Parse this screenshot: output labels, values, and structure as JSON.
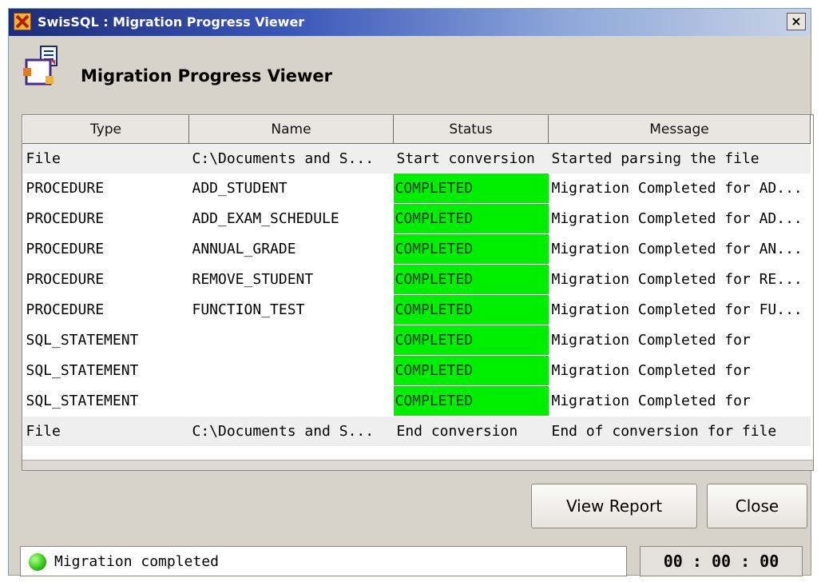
{
  "window": {
    "title": "SwisSQL : Migration Progress Viewer",
    "close_symbol": "×",
    "app_icon": "swissql-logo-icon",
    "close_icon": "close-icon"
  },
  "header": {
    "title": "Migration Progress Viewer",
    "icon": "migration-viewer-icon"
  },
  "table": {
    "columns": [
      "Type",
      "Name",
      "Status",
      "Message"
    ],
    "rows": [
      {
        "type": "File",
        "name": "C:\\Documents and S...",
        "status": "Start conversion",
        "message": "Started parsing the file"
      },
      {
        "type": "PROCEDURE",
        "name": "ADD_STUDENT",
        "status": "COMPLETED",
        "message": "Migration Completed for AD..."
      },
      {
        "type": "PROCEDURE",
        "name": "ADD_EXAM_SCHEDULE",
        "status": "COMPLETED",
        "message": "Migration Completed for AD..."
      },
      {
        "type": "PROCEDURE",
        "name": "ANNUAL_GRADE",
        "status": "COMPLETED",
        "message": "Migration Completed for AN..."
      },
      {
        "type": "PROCEDURE",
        "name": "REMOVE_STUDENT",
        "status": "COMPLETED",
        "message": "Migration Completed for RE..."
      },
      {
        "type": "PROCEDURE",
        "name": "FUNCTION_TEST",
        "status": "COMPLETED",
        "message": "Migration Completed for FU..."
      },
      {
        "type": "SQL_STATEMENT",
        "name": "",
        "status": "COMPLETED",
        "message": "Migration Completed for"
      },
      {
        "type": "SQL_STATEMENT",
        "name": "",
        "status": "COMPLETED",
        "message": "Migration Completed for"
      },
      {
        "type": "SQL_STATEMENT",
        "name": "",
        "status": "COMPLETED",
        "message": "Migration Completed for"
      },
      {
        "type": "File",
        "name": "C:\\Documents and S...",
        "status": "End conversion",
        "message": "End of conversion for file"
      }
    ]
  },
  "buttons": {
    "view_report": "View Report",
    "close": "Close"
  },
  "status_bar": {
    "text": "Migration completed",
    "indicator_icon": "green-status-led-icon",
    "timer": "00 : 00 : 00"
  },
  "colors": {
    "completed_status": "#00ee00",
    "title_bar_start": "#1e2c7a",
    "title_bar_end": "#c9d3e6",
    "dialog_background": "#d7d3cb"
  }
}
